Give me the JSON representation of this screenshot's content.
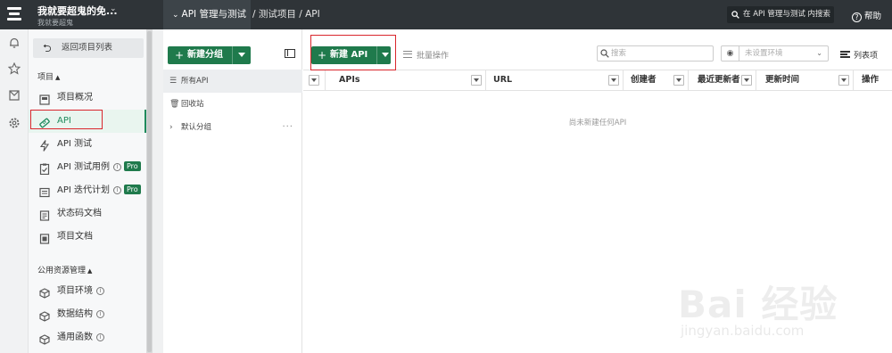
{
  "topbar": {
    "project_title": "我就要超鬼的免...",
    "project_sub": "我就要超鬼",
    "module": "API 管理与测试",
    "breadcrumb": "/ 测试项目 / API",
    "search_placeholder": "在 API 管理与测试 内搜索",
    "help": "帮助"
  },
  "sidebar": {
    "back_label": "返回项目列表",
    "section_project": "项目",
    "items": [
      {
        "label": "项目概况",
        "icon": "overview-icon"
      },
      {
        "label": "API",
        "icon": "api-icon"
      },
      {
        "label": "API 测试",
        "icon": "lightning-icon"
      },
      {
        "label": "API 测试用例",
        "icon": "testcase-icon",
        "badge": "Pro"
      },
      {
        "label": "API 迭代计划",
        "icon": "plan-icon",
        "badge": "Pro"
      },
      {
        "label": "状态码文档",
        "icon": "doc-icon"
      },
      {
        "label": "项目文档",
        "icon": "project-doc-icon"
      }
    ],
    "section_shared": "公用资源管理",
    "shared_items": [
      {
        "label": "项目环境",
        "icon": "cube-icon"
      },
      {
        "label": "数据结构",
        "icon": "cube-icon"
      },
      {
        "label": "通用函数",
        "icon": "cube-icon"
      }
    ]
  },
  "groups": {
    "new_group": "新建分组",
    "all_api": "所有API",
    "recycle": "回收站",
    "default_group": "默认分组",
    "more": "···"
  },
  "main": {
    "new_api": "新建 API",
    "batch": "批量操作",
    "search_placeholder": "搜索",
    "env_placeholder": "未设置环境",
    "list_view": "列表项",
    "columns": [
      "APIs",
      "URL",
      "创建者",
      "最近更新者",
      "更新时间",
      "操作"
    ],
    "empty": "尚未新建任何API"
  },
  "watermark": {
    "big": "Bai 经验",
    "small": "jingyan.baidu.com"
  },
  "colors": {
    "topbar": "#2f3438",
    "accent_green": "#1f7a4c",
    "highlight_red": "#d9262c"
  }
}
